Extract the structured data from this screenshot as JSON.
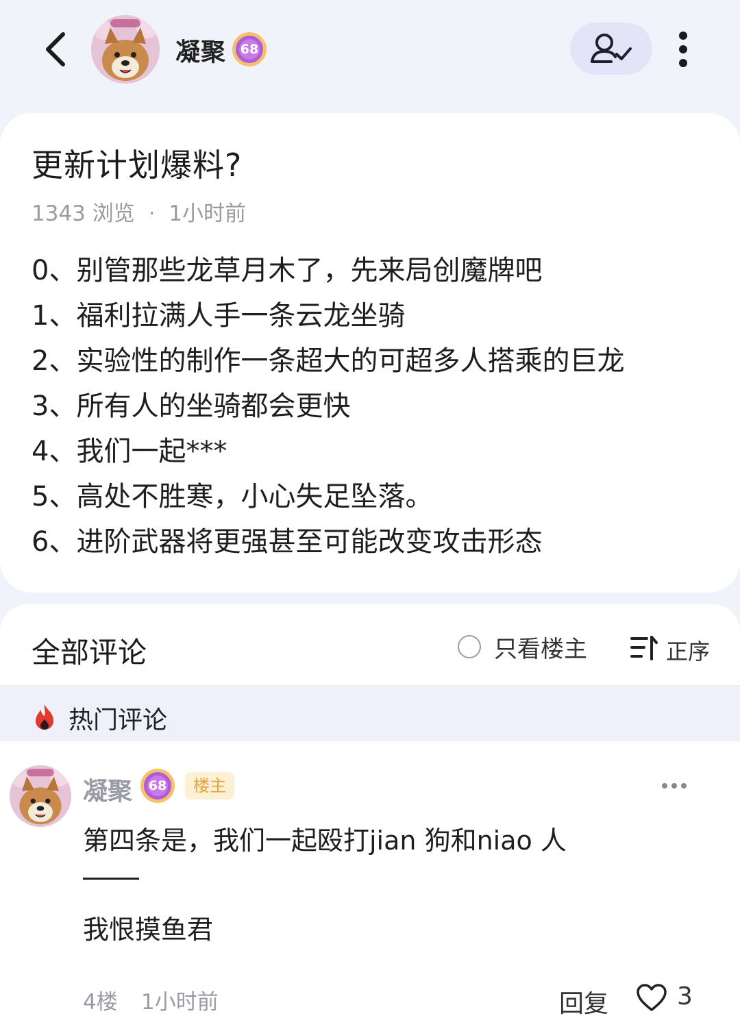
{
  "header": {
    "author_name": "凝聚",
    "level": "68"
  },
  "post": {
    "title": "更新计划爆料?",
    "views": "1343 浏览",
    "separator": "·",
    "time": "1小时前",
    "lines": [
      "0、别管那些龙草月木了，先来局创魔牌吧",
      "1、福利拉满人手一条云龙坐骑",
      "2、实验性的制作一条超大的可超多人搭乘的巨龙",
      "3、所有人的坐骑都会更快",
      "4、我们一起***",
      "5、高处不胜寒，小心失足坠落。",
      "6、进阶武器将更强甚至可能改变攻击形态"
    ]
  },
  "comments_header": {
    "title": "全部评论",
    "owner_only": "只看楼主",
    "sort": "正序"
  },
  "hot": {
    "label": "热门评论"
  },
  "comment": {
    "name": "凝聚",
    "level": "68",
    "owner_tag": "楼主",
    "line1": "第四条是，我们一起殴打jian 狗和niao 人",
    "line2": "我恨摸鱼君",
    "floor": "4楼",
    "time": "1小时前",
    "reply": "回复",
    "likes": "3"
  },
  "colors": {
    "background": "#f1f3fb",
    "follow_button": "#e3e4f8",
    "owner_tag_bg": "#fdf0d5",
    "owner_tag_text": "#e3a33a",
    "level_badge": "#b15bd8",
    "hot_icon": "#e03a2f"
  },
  "icons": {
    "back": "chevron-left-icon",
    "follow": "user-check-icon",
    "more": "vertical-dots-icon",
    "sort": "sort-lines-icon",
    "hot": "flame-icon",
    "like": "heart-icon"
  }
}
